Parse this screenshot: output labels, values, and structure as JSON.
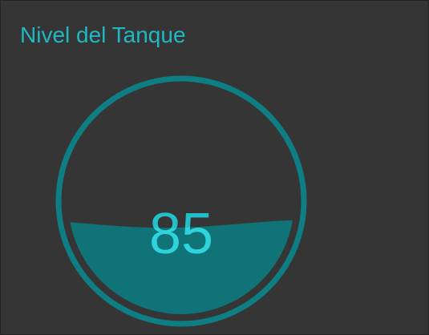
{
  "widget": {
    "title": "Nivel del Tanque",
    "value_text": "85"
  },
  "gauge": {
    "level_percent": 40,
    "colors": {
      "accent": "#1fb9c4",
      "ring": "#0d7e84",
      "fill": "#0f7377",
      "text": "#22c0c9",
      "background": "#353535"
    }
  }
}
